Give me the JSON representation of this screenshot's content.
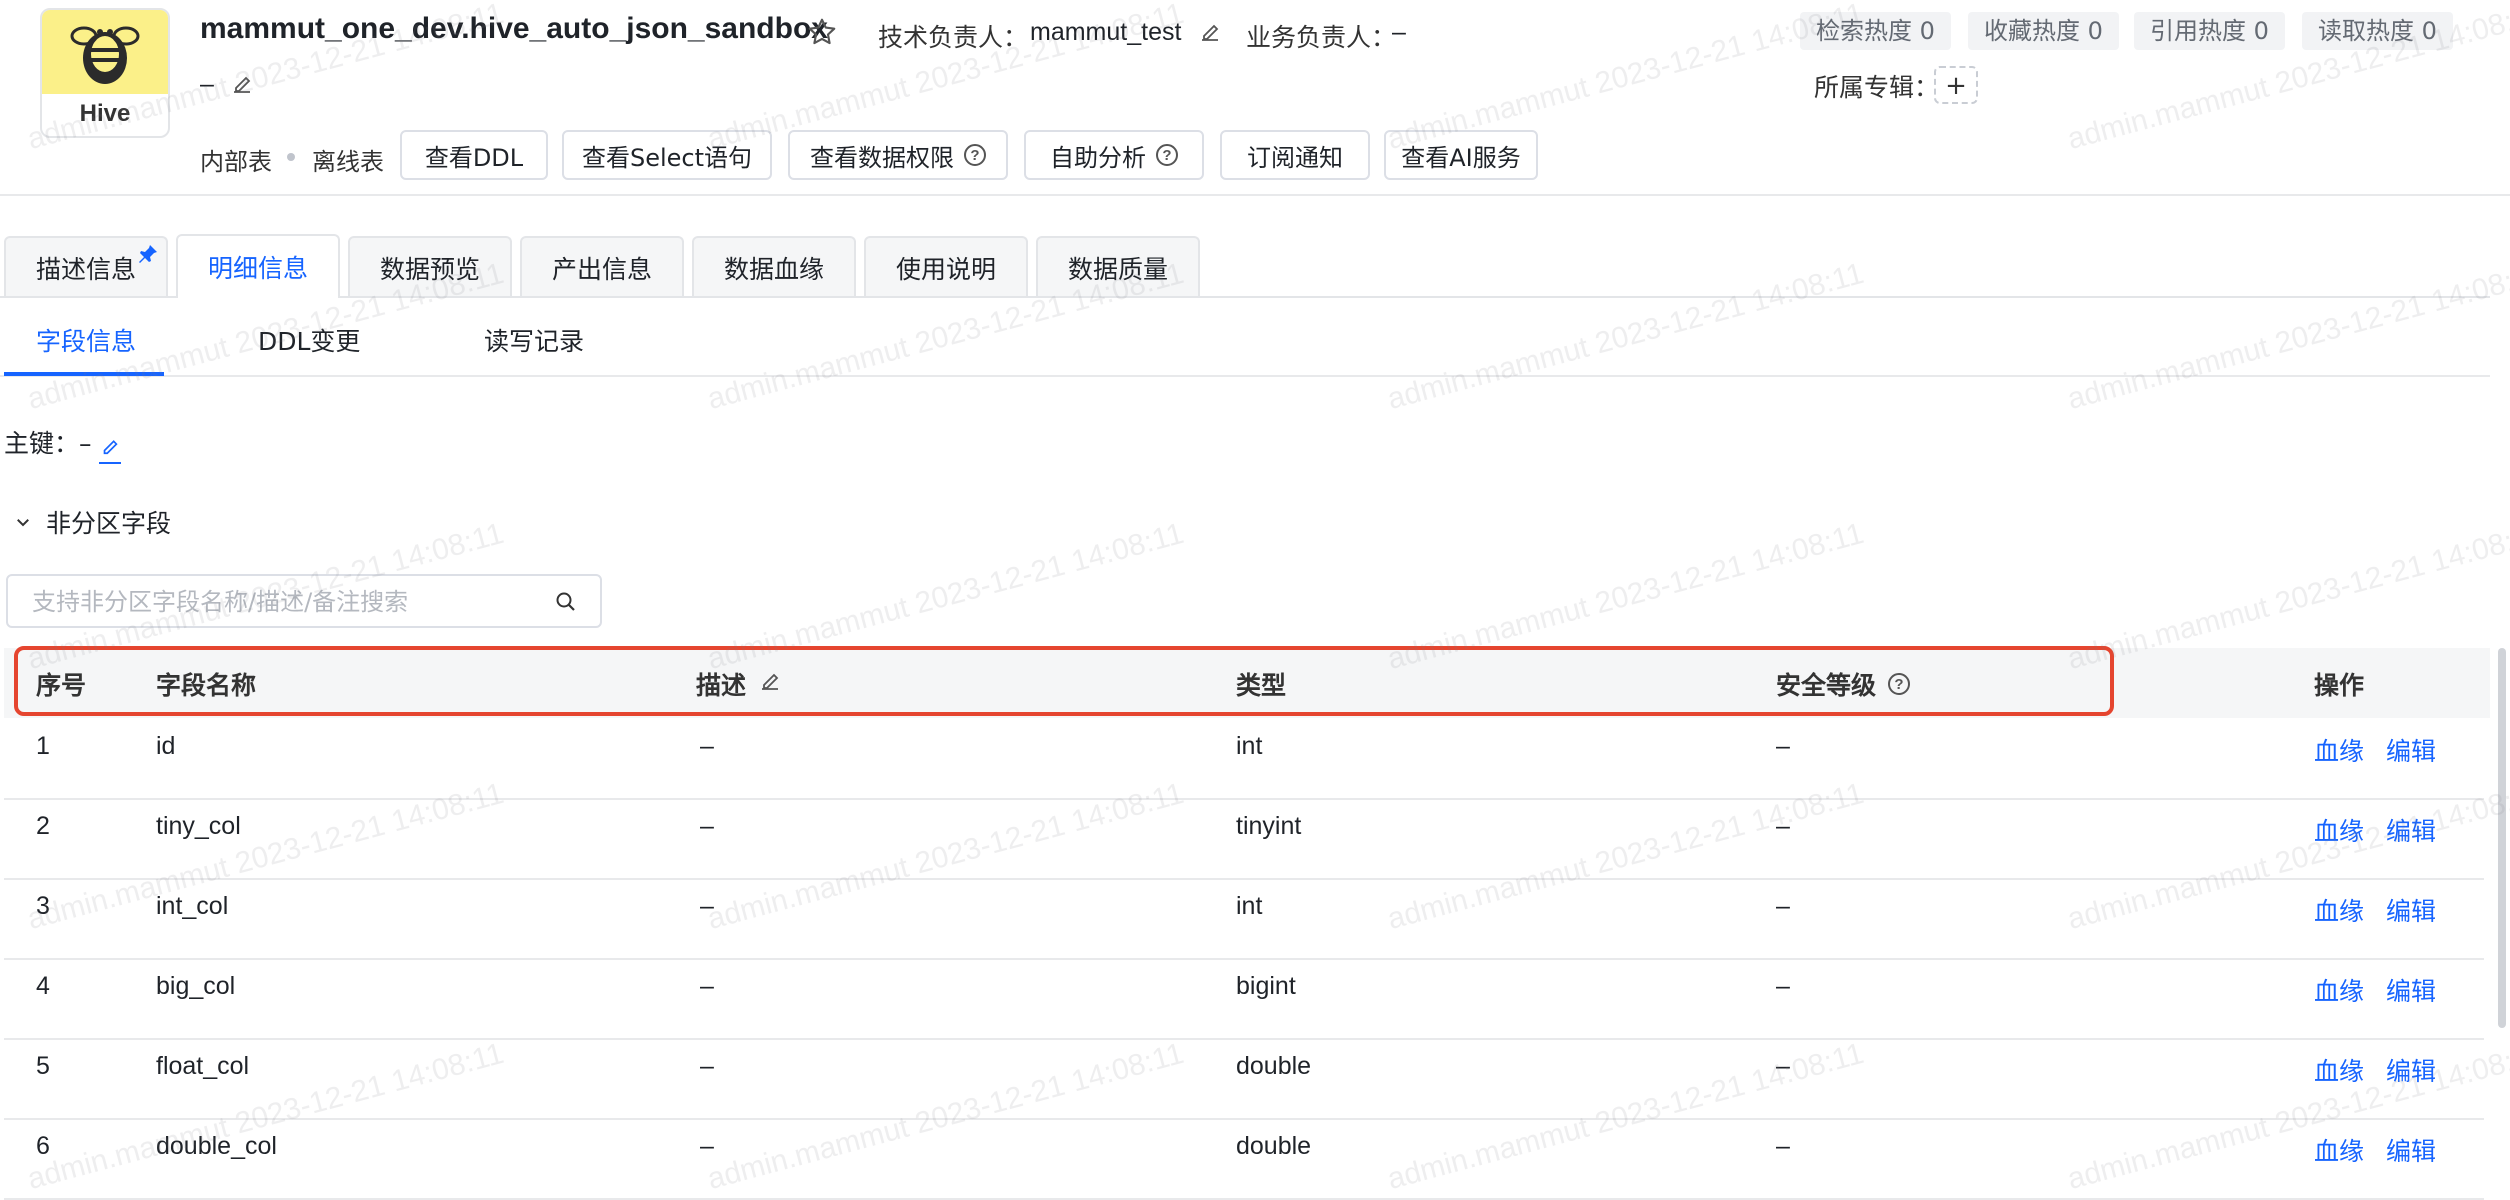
{
  "header": {
    "logo_label": "Hive",
    "title": "mammut_one_dev.hive_auto_json_sandbox",
    "tech_owner_label": "技术负责人：",
    "tech_owner_value": "mammut_test",
    "biz_owner_label": "业务负责人：",
    "biz_owner_value": "–",
    "description_value": "–",
    "heat_tags": [
      "检索热度 0",
      "收藏热度 0",
      "引用热度 0",
      "读取热度 0"
    ],
    "topic_label": "所属专辑：",
    "topic_add": "+",
    "table_kind_1": "内部表",
    "table_kind_2": "离线表",
    "buttons": {
      "view_ddl": "查看DDL",
      "view_select": "查看Select语句",
      "view_permission": "查看数据权限",
      "self_analysis": "自助分析",
      "subscribe": "订阅通知",
      "ai_service": "查看AI服务"
    }
  },
  "tabs": [
    "描述信息",
    "明细信息",
    "数据预览",
    "产出信息",
    "数据血缘",
    "使用说明",
    "数据质量"
  ],
  "subtabs": [
    "字段信息",
    "DDL变更",
    "读写记录"
  ],
  "primary_key_label": "主键：",
  "primary_key_value": "–",
  "section_title": "非分区字段",
  "search": {
    "placeholder": "支持非分区字段名称/描述/备注搜索"
  },
  "table": {
    "headers": {
      "index": "序号",
      "name": "字段名称",
      "desc": "描述",
      "type": "类型",
      "security": "安全等级",
      "ops": "操作"
    },
    "rows": [
      {
        "index": "1",
        "name": "id",
        "desc": "–",
        "type": "int",
        "security": "–",
        "op1": "血缘",
        "op2": "编辑"
      },
      {
        "index": "2",
        "name": "tiny_col",
        "desc": "–",
        "type": "tinyint",
        "security": "–",
        "op1": "血缘",
        "op2": "编辑"
      },
      {
        "index": "3",
        "name": "int_col",
        "desc": "–",
        "type": "int",
        "security": "–",
        "op1": "血缘",
        "op2": "编辑"
      },
      {
        "index": "4",
        "name": "big_col",
        "desc": "–",
        "type": "bigint",
        "security": "–",
        "op1": "血缘",
        "op2": "编辑"
      },
      {
        "index": "5",
        "name": "float_col",
        "desc": "–",
        "type": "double",
        "security": "–",
        "op1": "血缘",
        "op2": "编辑"
      },
      {
        "index": "6",
        "name": "double_col",
        "desc": "–",
        "type": "double",
        "security": "–",
        "op1": "血缘",
        "op2": "编辑"
      }
    ]
  },
  "watermark": "admin.mammut 2023-12-21 14:08:11",
  "colors": {
    "accent": "#1664ff",
    "highlight": "#e5452f",
    "logo_bg": "#fbf089"
  }
}
